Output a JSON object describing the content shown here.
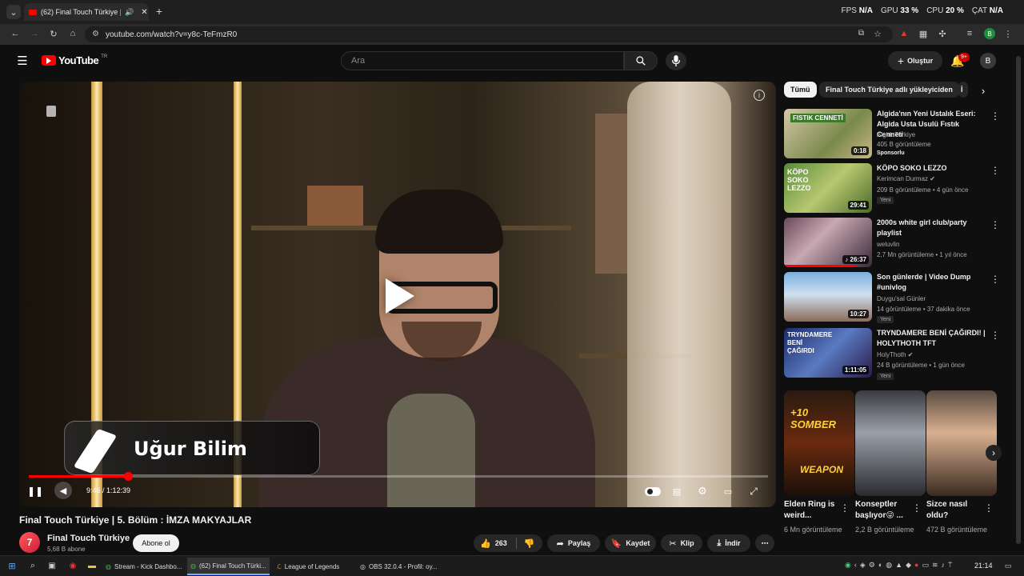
{
  "browser": {
    "tab_title": "(62) Final Touch Türkiye | 5...",
    "url": "youtube.com/watch?v=y8c-TeFmzR0",
    "overlay": {
      "fps_label": "FPS",
      "fps": "N/A",
      "gpu_label": "GPU",
      "gpu": "33 %",
      "cpu_label": "CPU",
      "cpu": "20 %",
      "cat_label": "ÇAT",
      "cat": "N/A"
    }
  },
  "header": {
    "logo_text": "YouTube",
    "region": "TR",
    "search_placeholder": "Ara",
    "create_label": "Oluştur",
    "notif_count": "9+",
    "avatar_letter": "B"
  },
  "player": {
    "lower_third_name": "Uğur Bilim",
    "time": "9:46 / 1:12:39",
    "progress": 0.134
  },
  "video": {
    "title": "Final Touch Türkiye | 5. Bölüm : İMZA MAKYAJLAR",
    "channel": "Final Touch Türkiye",
    "channel_initial": "7",
    "subs": "5,68 B abone",
    "subscribe_label": "Abone ol",
    "likes": "263",
    "share_label": "Paylaş",
    "save_label": "Kaydet",
    "clip_label": "Klip",
    "download_label": "İndir"
  },
  "sidebar": {
    "chips": [
      "Tümü",
      "Final Touch Türkiye adlı yükleyiciden",
      "İ"
    ],
    "recs": [
      {
        "title": "Algida'nın Yeni Ustalık Eseri: Algida Usta Usulü Fıstık Cenneti",
        "channel": "AlgidaTurkiye",
        "stats": "405 B görüntüleme",
        "extra": "Sponsorlu",
        "duration": "0:18",
        "thumb_text": "FISTIK CENNETİ"
      },
      {
        "title": "KÖPO SOKO LEZZO",
        "channel": "Kerimcan Durmaz",
        "stats": "209 B görüntüleme • 4 gün önce",
        "extra": "Yeni",
        "duration": "29:41",
        "thumb_text": "KÖPO SOKO LEZZO"
      },
      {
        "title": "2000s white girl club/party playlist",
        "channel": "weluvlin",
        "stats": "2,7 Mn görüntüleme • 1 yıl önce",
        "extra": "",
        "duration": "26:37",
        "thumb_text": ""
      },
      {
        "title": "Son günlerde | Video Dump #univlog",
        "channel": "Duygu'sal Günler",
        "stats": "14 görüntüleme • 37 dakika önce",
        "extra": "Yeni",
        "duration": "10:27",
        "thumb_text": ""
      },
      {
        "title": "TRYNDAMERE BENİ ÇAĞIRDI! | HOLYTHOTH TFT",
        "channel": "HolyThoth",
        "stats": "24 B görüntüleme • 1 gün önce",
        "extra": "Yeni",
        "duration": "1:11:05",
        "thumb_text": "TRYNDAMERE BENİ ÇAĞIRDI"
      }
    ],
    "shorts": [
      {
        "title": "Elden Ring is weird...",
        "views": "6 Mn görüntüleme",
        "thumb_top": "+10 SOMBER",
        "thumb_bottom": "WEAPON"
      },
      {
        "title": "Konseptler başlıyor😜 ...",
        "views": "2,2 B görüntüleme",
        "thumb_top": "",
        "thumb_bottom": ""
      },
      {
        "title": "Sizce nasıl oldu?",
        "views": "472 B görüntüleme",
        "thumb_top": "",
        "thumb_bottom": ""
      }
    ]
  },
  "taskbar": {
    "items": [
      "Stream - Kick Dashbo...",
      "(62) Final Touch Türki...",
      "League of Legends",
      "OBS 32.0.4 - Profil: oy..."
    ],
    "clock": "21:14"
  }
}
